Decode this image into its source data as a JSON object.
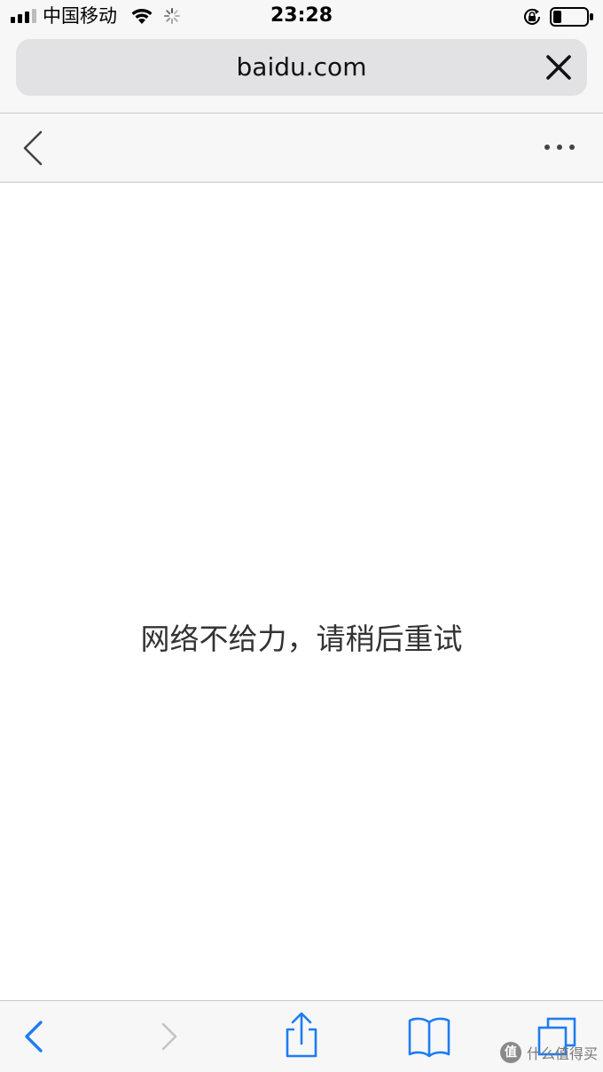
{
  "status_bar": {
    "carrier": "中国移动",
    "time": "23:28"
  },
  "address_bar": {
    "url": "baidu.com"
  },
  "content": {
    "error_message": "网络不给力，请稍后重试"
  },
  "watermark": {
    "text": "什么值得买",
    "logo": "值"
  },
  "icons": {
    "accent": "#1e7cf2",
    "disabled": "#c4c4c4"
  }
}
